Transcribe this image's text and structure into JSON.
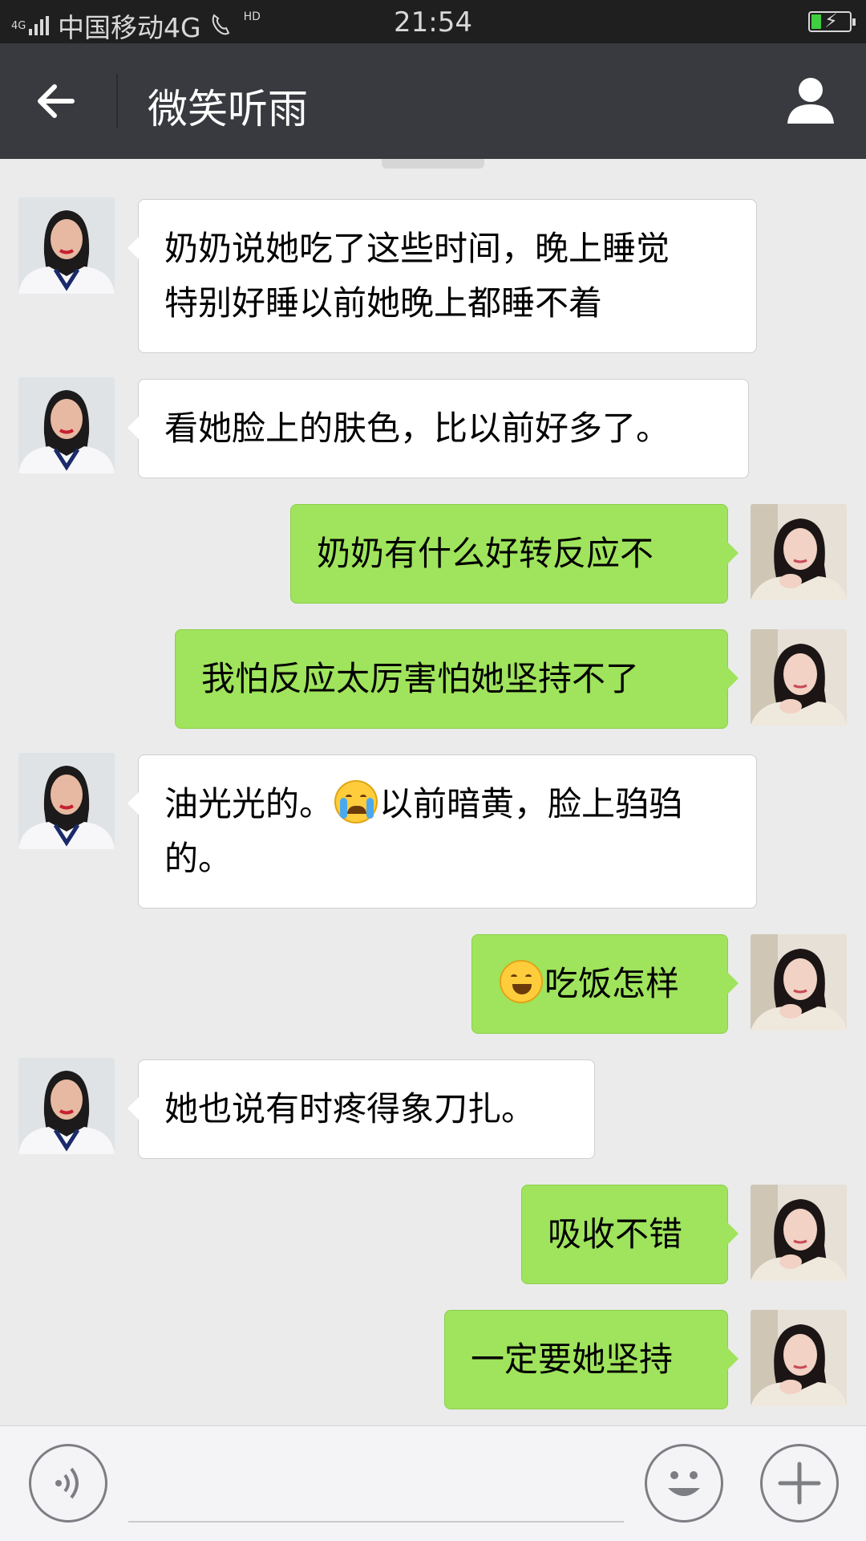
{
  "status_bar": {
    "signal_label": "4G",
    "carrier": "中国移动4G",
    "hd_label": "HD",
    "time": "21:54"
  },
  "header": {
    "title": "微笑听雨"
  },
  "colors": {
    "header_bg": "#393a3f",
    "chat_bg": "#ebebeb",
    "outgoing_bubble": "#9fe45c",
    "incoming_bubble": "#ffffff",
    "input_bar_bg": "#f4f4f6"
  },
  "messages": [
    {
      "side": "in",
      "text": "奶奶说她吃了这些时间，晚上睡觉\n特别好睡以前她晚上都睡不着"
    },
    {
      "side": "in",
      "text": "看她脸上的肤色，比以前好多了。"
    },
    {
      "side": "out",
      "text": "奶奶有什么好转反应不"
    },
    {
      "side": "out",
      "text": "我怕反应太厉害怕她坚持不了"
    },
    {
      "side": "in",
      "text_before": "油光光的。",
      "emoji": "loudly-crying-face-emoji",
      "text_after": "以前暗黄，脸上驺驺\n的。"
    },
    {
      "side": "out",
      "emoji": "grinning-face-emoji",
      "text_after": "吃饭怎样"
    },
    {
      "side": "in",
      "text": "她也说有时疼得象刀扎。"
    },
    {
      "side": "out",
      "text": "吸收不错"
    },
    {
      "side": "out",
      "text": "一定要她坚持"
    }
  ],
  "input_bar": {
    "voice_icon": "voice-icon",
    "emoji_icon": "smiley-icon",
    "more_icon": "plus-icon",
    "input_value": ""
  }
}
